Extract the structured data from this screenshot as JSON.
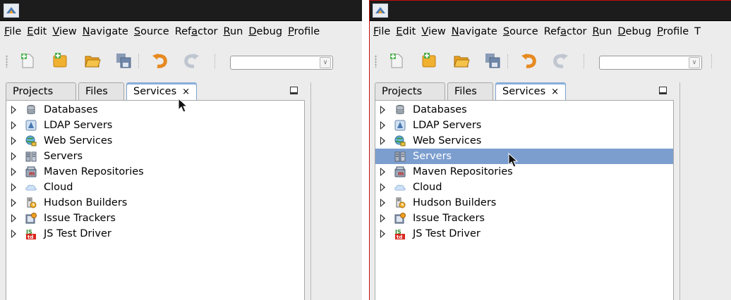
{
  "screens": [
    {
      "menus": [
        "File",
        "Edit",
        "View",
        "Navigate",
        "Source",
        "Refactor",
        "Run",
        "Debug",
        "Profile"
      ],
      "mnemonics": [
        "F",
        "E",
        "V",
        "N",
        "S",
        "a",
        "R",
        "D",
        "P"
      ],
      "tabs": [
        "Projects",
        "Files",
        "Services"
      ],
      "active_tab": "Services",
      "tab_close_glyph": "×",
      "selected_node": "",
      "tree": [
        {
          "label": "Databases",
          "icon": "database-icon"
        },
        {
          "label": "LDAP Servers",
          "icon": "ldap-icon"
        },
        {
          "label": "Web Services",
          "icon": "web-services-icon"
        },
        {
          "label": "Servers",
          "icon": "servers-icon"
        },
        {
          "label": "Maven Repositories",
          "icon": "maven-icon"
        },
        {
          "label": "Cloud",
          "icon": "cloud-icon"
        },
        {
          "label": "Hudson Builders",
          "icon": "hudson-icon"
        },
        {
          "label": "Issue Trackers",
          "icon": "issue-tracker-icon"
        },
        {
          "label": "JS Test Driver",
          "icon": "js-test-driver-icon"
        }
      ]
    },
    {
      "menus": [
        "File",
        "Edit",
        "View",
        "Navigate",
        "Source",
        "Refactor",
        "Run",
        "Debug",
        "Profile",
        "T"
      ],
      "mnemonics": [
        "F",
        "E",
        "V",
        "N",
        "S",
        "a",
        "R",
        "D",
        "P",
        ""
      ],
      "tabs": [
        "Projects",
        "Files",
        "Services"
      ],
      "active_tab": "Services",
      "tab_close_glyph": "×",
      "selected_node": "Servers",
      "tree": [
        {
          "label": "Databases",
          "icon": "database-icon"
        },
        {
          "label": "LDAP Servers",
          "icon": "ldap-icon"
        },
        {
          "label": "Web Services",
          "icon": "web-services-icon"
        },
        {
          "label": "Servers",
          "icon": "servers-icon"
        },
        {
          "label": "Maven Repositories",
          "icon": "maven-icon"
        },
        {
          "label": "Cloud",
          "icon": "cloud-icon"
        },
        {
          "label": "Hudson Builders",
          "icon": "hudson-icon"
        },
        {
          "label": "Issue Trackers",
          "icon": "issue-tracker-icon"
        },
        {
          "label": "JS Test Driver",
          "icon": "js-test-driver-icon"
        }
      ]
    }
  ],
  "toolbar_icons": [
    "new-file-icon",
    "new-project-icon",
    "open-project-icon",
    "save-all-icon",
    "undo-icon",
    "redo-icon"
  ],
  "colors": {
    "title_bar": "#1c1c1c",
    "selection": "#7c9ecf",
    "active_tab_border": "#7fa4d0",
    "window_focus_border": "#c01010"
  }
}
